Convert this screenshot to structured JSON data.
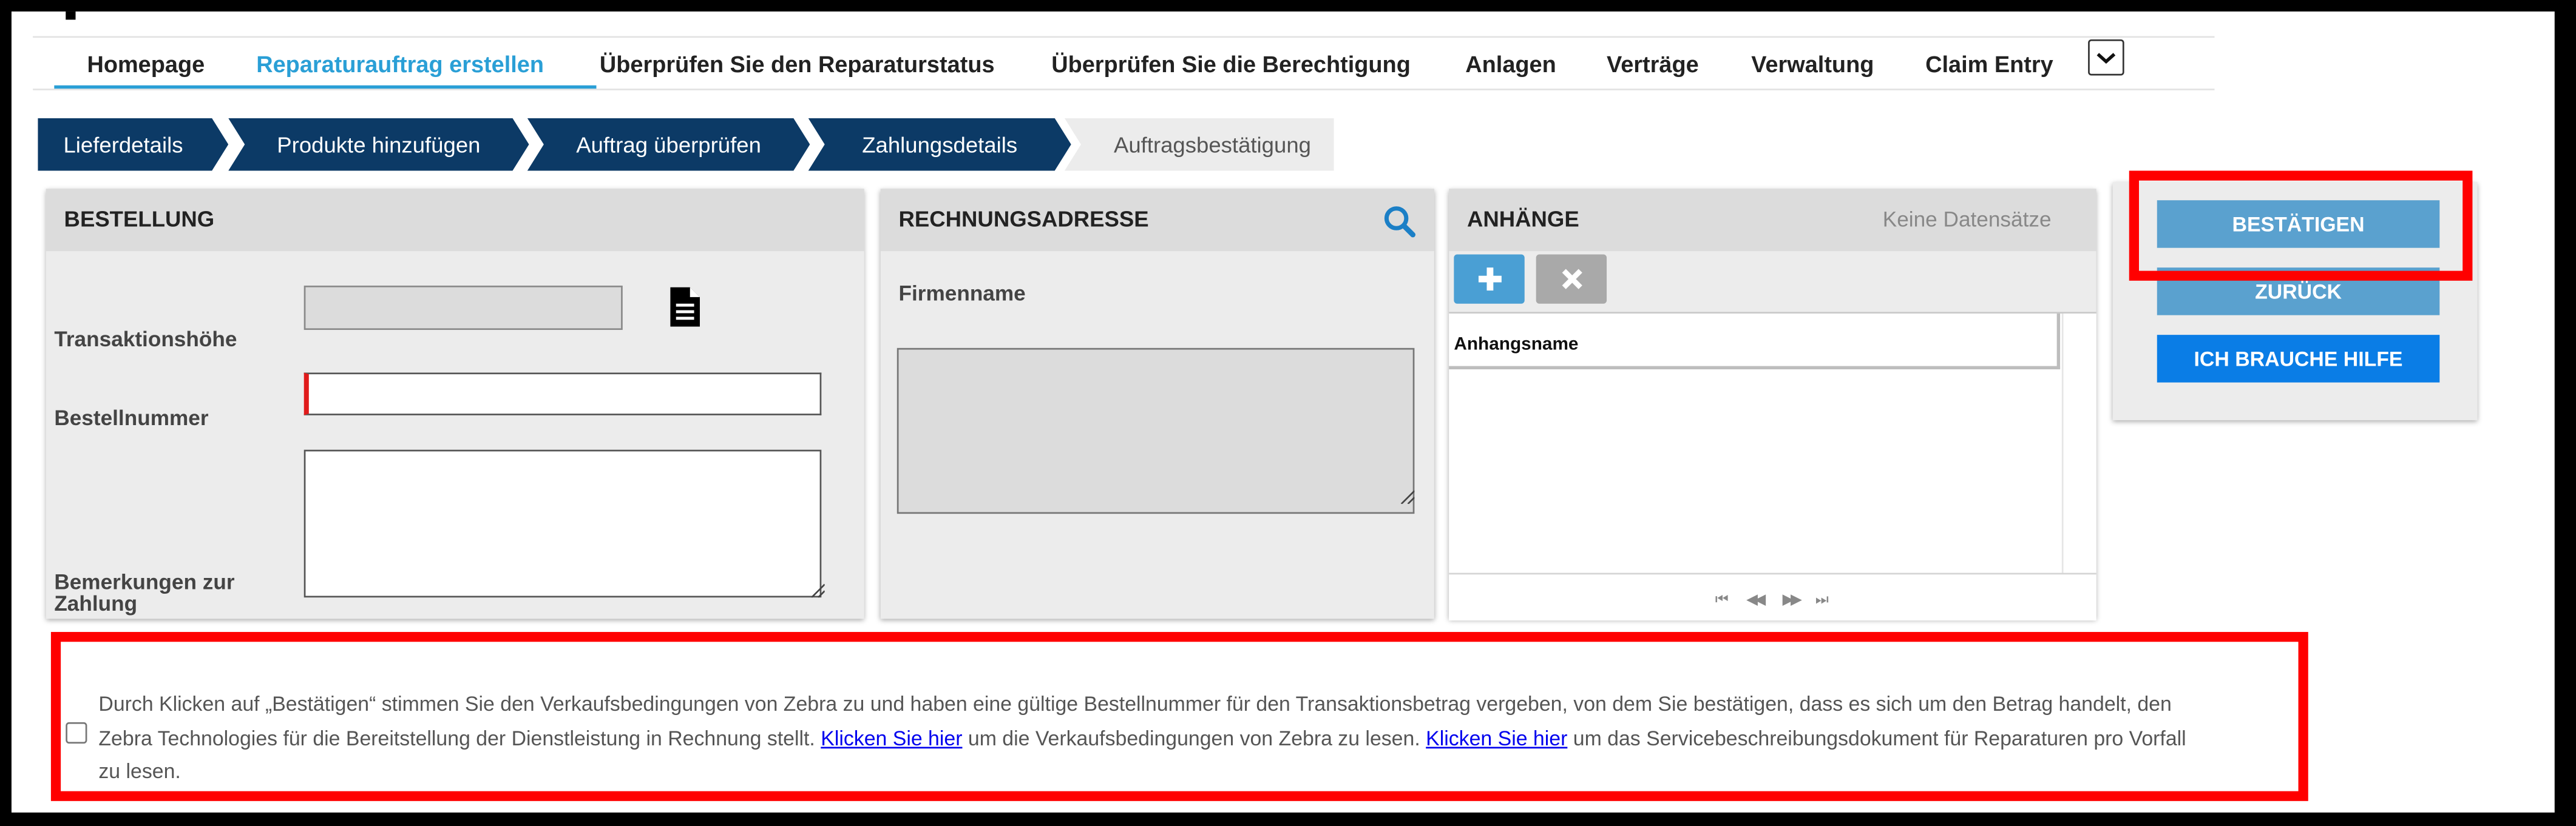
{
  "menu": {
    "items": [
      {
        "label": "Homepage"
      },
      {
        "label": "Reparaturauftrag erstellen"
      },
      {
        "label": "Überprüfen Sie den Reparaturstatus"
      },
      {
        "label": "Überprüfen Sie die Berechtigung"
      },
      {
        "label": "Anlagen"
      },
      {
        "label": "Verträge"
      },
      {
        "label": "Verwaltung"
      },
      {
        "label": "Claim Entry"
      }
    ],
    "active_index": 1,
    "more_icon": "chevron-down-icon"
  },
  "steps": [
    {
      "label": "Lieferdetails",
      "state": "done"
    },
    {
      "label": "Produkte hinzufügen",
      "state": "done"
    },
    {
      "label": "Auftrag überprüfen",
      "state": "done"
    },
    {
      "label": "Zahlungsdetails",
      "state": "done"
    },
    {
      "label": "Auftragsbestätigung",
      "state": "pending"
    }
  ],
  "order_panel": {
    "title": "BESTELLUNG",
    "transaction_label": "Transaktionshöhe",
    "transaction_value": "",
    "document_icon": "document-icon",
    "order_number_label": "Bestellnummer",
    "order_number_value": "",
    "remarks_label": "Bemerkungen zur Zahlung",
    "remarks_value": ""
  },
  "billing_panel": {
    "title": "RECHNUNGSADRESSE",
    "search_icon": "search-icon",
    "company_label": "Firmenname",
    "company_value": ""
  },
  "attachments_panel": {
    "title": "ANHÄNGE",
    "status": "Keine Datensätze",
    "add_icon": "plus-icon",
    "remove_icon": "close-icon",
    "column_header": "Anhangsname",
    "pager_icons": [
      "first-page-icon",
      "previous-page-icon",
      "next-page-icon",
      "last-page-icon"
    ]
  },
  "actions": {
    "confirm": "BESTÄTIGEN",
    "back": "ZURÜCK",
    "help": "ICH BRAUCHE HILFE"
  },
  "terms": {
    "checked": false,
    "text_1": "Durch Klicken auf „Bestätigen“ stimmen Sie den Verkaufsbedingungen von Zebra zu und haben eine gültige Bestellnummer für den Transaktionsbetrag vergeben, von dem Sie bestätigen, dass es sich um den Betrag handelt, den Zebra Technologies für die Bereitstellung der Dienstleistung in Rechnung stellt.",
    "link_1": "Klicken Sie hier",
    "text_2": "um die Verkaufsbedingungen von Zebra zu lesen.",
    "link_2": "Klicken Sie hier",
    "text_3": "um das Servicebeschreibungsdokument für Reparaturen pro Vorfall zu lesen."
  },
  "colors": {
    "accent": "#2a9fd6",
    "step_done": "#0c3a66",
    "button_blue_light": "#5aa1cf",
    "button_blue": "#0a7de6",
    "highlight": "#ff0000"
  }
}
